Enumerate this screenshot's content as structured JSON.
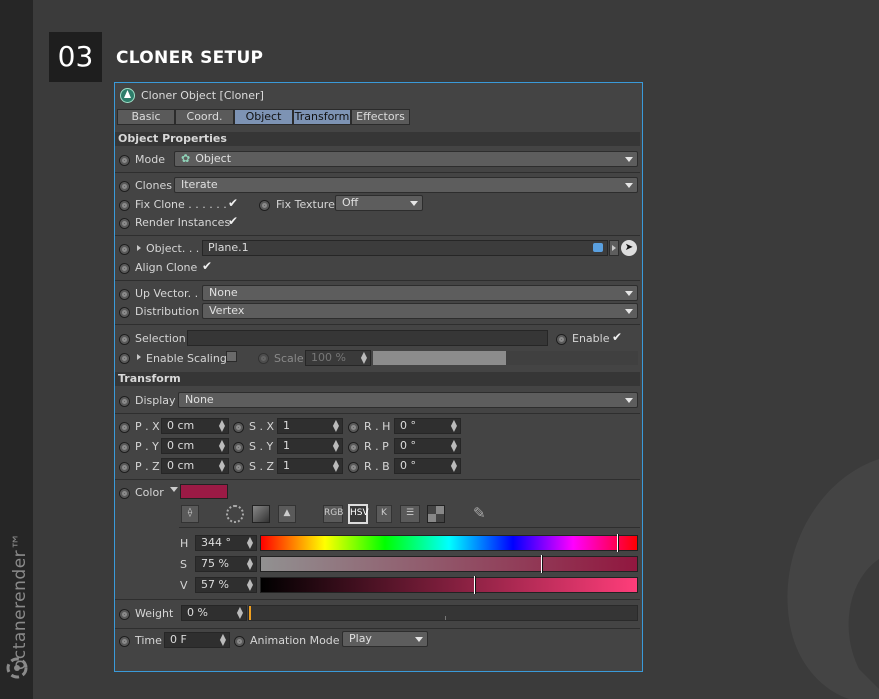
{
  "brand": {
    "text": "octanerender™"
  },
  "step": {
    "number": "03",
    "title": "CLONER SETUP"
  },
  "panel": {
    "title": "Cloner Object [Cloner]",
    "tabs": [
      {
        "label": "Basic",
        "active": false
      },
      {
        "label": "Coord.",
        "active": false
      },
      {
        "label": "Object",
        "active": true
      },
      {
        "label": "Transform",
        "active": true
      },
      {
        "label": "Effectors",
        "active": false
      }
    ],
    "object_properties": {
      "heading": "Object Properties",
      "mode_label": "Mode",
      "mode_value": "Object",
      "clones_label": "Clones",
      "clones_value": "Iterate",
      "fix_clone_label": "Fix Clone . . . . . .",
      "fix_clone_checked": true,
      "fix_texture_label": "Fix Texture",
      "fix_texture_value": "Off",
      "render_instances_label": "Render Instances",
      "render_instances_checked": true,
      "object_label": "Object. . .",
      "object_value": "Plane.1",
      "align_clone_label": "Align Clone",
      "align_clone_checked": true,
      "up_vector_label": "Up Vector. .",
      "up_vector_value": "None",
      "distribution_label": "Distribution",
      "distribution_value": "Vertex",
      "selection_label": "Selection",
      "selection_value": "",
      "enable_label": "Enable",
      "enable_checked": true,
      "enable_scaling_label": "Enable Scaling",
      "scale_label": "Scale",
      "scale_value": "100 %"
    },
    "transform": {
      "heading": "Transform",
      "display_label": "Display",
      "display_value": "None",
      "position": [
        {
          "label": "P . X",
          "value": "0 cm"
        },
        {
          "label": "P . Y",
          "value": "0 cm"
        },
        {
          "label": "P . Z",
          "value": "0 cm"
        }
      ],
      "scale": [
        {
          "label": "S . X",
          "value": "1"
        },
        {
          "label": "S . Y",
          "value": "1"
        },
        {
          "label": "S . Z",
          "value": "1"
        }
      ],
      "rotation": [
        {
          "label": "R . H",
          "value": "0 °"
        },
        {
          "label": "R . P",
          "value": "0 °"
        },
        {
          "label": "R . B",
          "value": "0 °"
        }
      ],
      "color_label": "Color",
      "color_swatch": "#9b1a45",
      "color_modes": [
        "RGB",
        "HSV",
        "K"
      ],
      "hsv": [
        {
          "label": "H",
          "value": "344 °",
          "fraction": 0.955
        },
        {
          "label": "S",
          "value": "75 %",
          "fraction": 0.75
        },
        {
          "label": "V",
          "value": "57 %",
          "fraction": 0.57
        }
      ],
      "weight_label": "Weight",
      "weight_value": "0 %",
      "time_label": "Time",
      "time_value": "0 F",
      "animation_mode_label": "Animation Mode",
      "animation_mode_value": "Play"
    }
  },
  "colors": {
    "panel_border": "#3a9ad9",
    "tab_active": "#7d93b4"
  }
}
